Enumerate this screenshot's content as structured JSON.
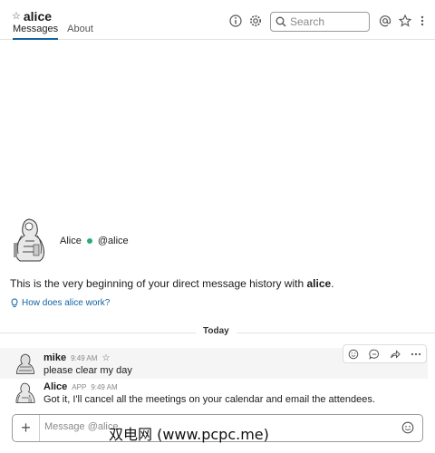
{
  "header": {
    "channel_name": "alice",
    "tabs": [
      {
        "label": "Messages",
        "active": true
      },
      {
        "label": "About",
        "active": false
      }
    ],
    "search_placeholder": "Search",
    "icons": [
      "star-outline-icon",
      "info-icon",
      "gear-icon",
      "search-icon",
      "at-icon",
      "star-icon",
      "more-vertical-icon"
    ]
  },
  "profile": {
    "name": "Alice",
    "handle": "@alice",
    "presence": "active"
  },
  "intro": {
    "text_before": "This is the very beginning of your direct message history with ",
    "name": "alice",
    "text_after": ".",
    "help_link": "How does alice work?"
  },
  "divider": {
    "label": "Today"
  },
  "messages": [
    {
      "author": "mike",
      "time": "9:49 AM",
      "badge": "",
      "text": "please clear my day"
    },
    {
      "author": "Alice",
      "badge": "APP",
      "time": "9:49 AM",
      "text": "Got it, I'll cancel all the meetings on your calendar and email the attendees."
    }
  ],
  "message_actions": [
    "add-reaction-icon",
    "reply-thread-icon",
    "share-icon",
    "more-horizontal-icon"
  ],
  "composer": {
    "placeholder": "Message @alice"
  },
  "watermark": "双电网 (www.pcpc.me)",
  "colors": {
    "accent": "#1264a3",
    "presence": "#2bac76",
    "hover_bg": "#f5f5f5"
  }
}
